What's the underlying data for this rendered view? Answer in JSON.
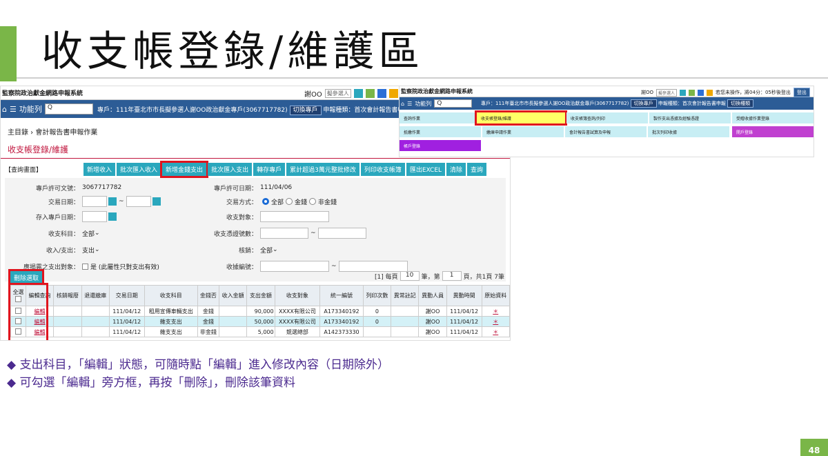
{
  "slide": {
    "title": "收支帳登錄/維護區",
    "page": "48"
  },
  "bullets": [
    "◆ 支出科目，「編輯」狀態，可隨時點「編輯」進入修改內容（日期除外）",
    "◆ 可勾選「編輯」旁方框，再按「刪除」，刪除該筆資料"
  ],
  "left": {
    "app_title": "監察院政治獻金網路申報系統",
    "user": "謝OO",
    "user_select": "擬參選人",
    "nav_label": "功能列",
    "search_placeholder": "Q",
    "account_info": "專戶：111年臺北市市長擬參選人謝OO政治獻金專戶(3067717782)",
    "switch_account": "切換專戶",
    "report_type": "申報種類：首次會計報告書申報",
    "switch_type": "切換種類",
    "breadcrumb": "主目錄 › 會計報告書申報作業",
    "page_title": "收支帳登錄/維護",
    "query_label": "【查詢畫面】",
    "buttons": [
      "新增收入",
      "批次匯入收入",
      "新增金錢支出",
      "批次匯入支出",
      "轉存專戶",
      "累計超過3萬元整批修改",
      "列印收支帳簿",
      "匯出EXCEL",
      "清除",
      "查詢"
    ],
    "form": {
      "permit_no_label": "專戶許可文號：",
      "permit_no": "3067717782",
      "permit_date_label": "專戶許可日期：",
      "permit_date": "111/04/06",
      "trade_date_label": "交易日期：",
      "tilde": "~",
      "trade_method_label": "交易方式：",
      "trade_opts": [
        "全部",
        "金錢",
        "非金錢"
      ],
      "deposit_date_label": "存入專戶日期：",
      "party_label": "收支對象：",
      "subject_label": "收支科目：",
      "subject_value": "全部",
      "voucher_label": "收支憑證號數：",
      "inout_label": "收入/支出：",
      "inout_value": "支出",
      "review_label": "核銷：",
      "review_value": "全部",
      "disclose_label": "應揭露之支出對象：",
      "disclose_value": "是 (此屬性只對支出有效)",
      "receipt_label": "收據編號："
    },
    "delete_button": "刪除選取",
    "pager": {
      "prefix": "[1] 每頁",
      "size": "10",
      "mid": "筆，第",
      "page": "1",
      "suffix": "頁，共1頁 7筆"
    },
    "table": {
      "headers": [
        "全選",
        "編輯查詢",
        "核銷報廢",
        "退還繳庫",
        "交易日期",
        "收支科目",
        "金錢否",
        "收入金額",
        "支出金額",
        "收支對象",
        "統一編號",
        "列印次數",
        "異常註記",
        "異動人員",
        "異動時間",
        "原始資料"
      ],
      "rows": [
        [
          "",
          "編輯",
          "",
          "",
          "111/04/12",
          "租用宣傳車輛支出",
          "金錢",
          "",
          "90,000",
          "XXXX有限公司",
          "A173340192",
          "0",
          "",
          "謝OO",
          "111/04/12",
          "＊"
        ],
        [
          "",
          "編輯",
          "",
          "",
          "111/04/12",
          "雜支支出",
          "金錢",
          "",
          "50,000",
          "XXXX有限公司",
          "A173340192",
          "0",
          "",
          "謝OO",
          "111/04/12",
          "＊"
        ],
        [
          "",
          "編輯",
          "",
          "",
          "111/04/12",
          "雜支支出",
          "非金錢",
          "",
          "5,000",
          "競選總部",
          "A142373330",
          "",
          "",
          "謝OO",
          "111/04/12",
          "＊"
        ]
      ]
    }
  },
  "right": {
    "app_title": "監察院政治獻金網路申報系統",
    "user": "謝OO",
    "user_select": "擬參選人",
    "idle": "若您未操作，將04分：05秒後登出",
    "logout": "登出",
    "nav_label": "功能列",
    "account_info": "專戶：111年臺北市市長擬參選人謝OO政治獻金專戶(3067717782)",
    "switch_account": "切換專戶",
    "report_type": "申報種類：首次會計報告書申報",
    "switch_type": "切換種類",
    "menu": [
      "查詢作業",
      "收支帳登錄/維護",
      "收支帳簿查詢/列印",
      "製作支出憑據及經驗憑證",
      "受贈收據作業登錄",
      "抵繳作業",
      "繳庫申請作業",
      "會計報告書試算及申報",
      "批次列印收據",
      "開戶登錄",
      "帳戶登錄"
    ]
  },
  "colors": {
    "accent": "#2aa7bd",
    "nav": "#2c5c96",
    "highlight": "#e0141e",
    "bullet": "#4b2a8f",
    "green": "#7ab648"
  }
}
